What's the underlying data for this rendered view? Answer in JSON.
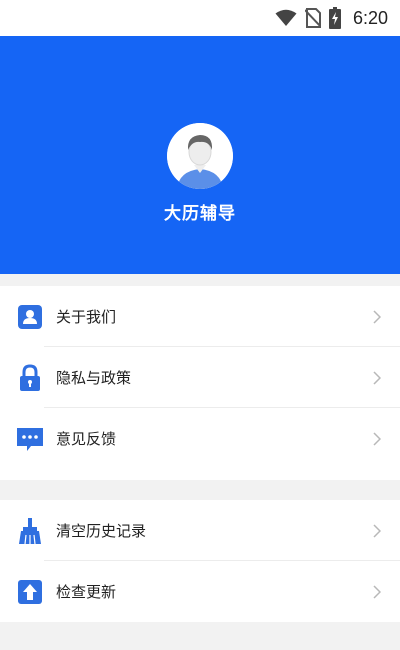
{
  "status_bar": {
    "time": "6:20",
    "icons": [
      "wifi-icon",
      "no-sim-icon",
      "battery-charging-icon"
    ]
  },
  "header": {
    "background_color": "#1565f5",
    "app_name": "大历辅导",
    "avatar_icon": "user-avatar-icon"
  },
  "menu": {
    "group1": [
      {
        "label": "关于我们",
        "icon": "person-icon"
      },
      {
        "label": "隐私与政策",
        "icon": "lock-icon"
      },
      {
        "label": "意见反馈",
        "icon": "feedback-icon"
      }
    ],
    "group2": [
      {
        "label": "清空历史记录",
        "icon": "broom-icon"
      },
      {
        "label": "检查更新",
        "icon": "upload-arrow-icon"
      }
    ]
  },
  "colors": {
    "accent": "#1565f5",
    "icon_blue": "#2f6fe0",
    "chevron": "#b8b8b8",
    "background": "#f2f2f2"
  }
}
